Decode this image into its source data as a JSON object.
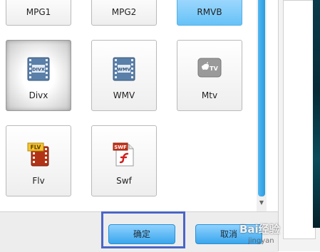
{
  "formats_top": [
    {
      "label": "MPG1"
    },
    {
      "label": "MPG2"
    },
    {
      "label": "RMVB"
    }
  ],
  "formats_mid": [
    {
      "label": "Divx",
      "icon_text": "DIVX",
      "icon": "film-divx-icon"
    },
    {
      "label": "WMV",
      "icon_text": "WMV",
      "icon": "film-wmv-icon"
    },
    {
      "label": "Mtv",
      "icon_text": "TV",
      "icon": "apple-tv-icon"
    }
  ],
  "formats_bottom": [
    {
      "label": "Flv",
      "icon_text": "FLV",
      "icon": "flash-flv-icon"
    },
    {
      "label": "Swf",
      "icon_text": "SWF",
      "icon": "flash-swf-icon"
    }
  ],
  "footer": {
    "ok_label": "确定",
    "cancel_label": "取消"
  },
  "watermark": {
    "text": "Bai经验",
    "sub": "jingyan"
  },
  "colors": {
    "accent": "#3aa6ec",
    "highlight": "#4b65c6"
  }
}
